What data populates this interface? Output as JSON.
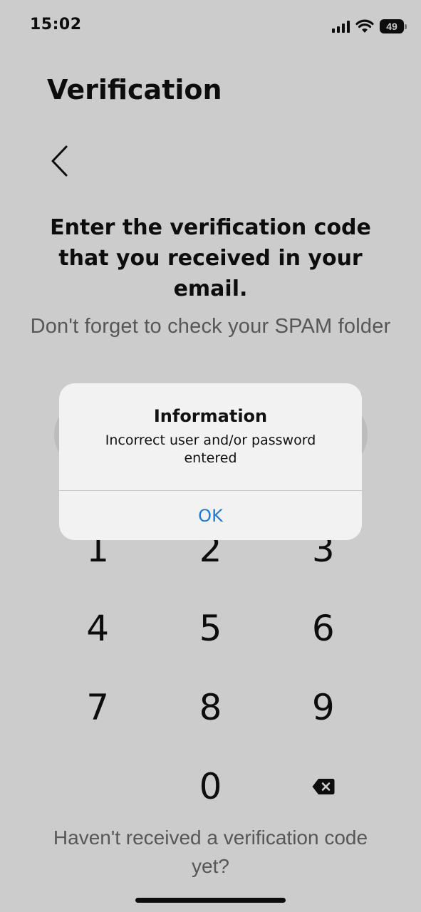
{
  "status_bar": {
    "time": "15:02",
    "battery": "49",
    "icons": [
      "signal-icon",
      "wifi-icon",
      "battery-icon"
    ]
  },
  "header": {
    "title": "Verification",
    "back_icon": "chevron-left-icon"
  },
  "main": {
    "instruction": "Enter the verification code that you received in your email.",
    "hint": "Don't forget to check your SPAM folder",
    "resend": "Haven't received a verification code yet?"
  },
  "keypad": {
    "keys": [
      "1",
      "2",
      "3",
      "4",
      "5",
      "6",
      "7",
      "8",
      "9",
      "0"
    ],
    "backspace_icon": "backspace-icon"
  },
  "dialog": {
    "title": "Information",
    "message": "Incorrect user and/or password entered",
    "ok_label": "OK"
  },
  "colors": {
    "accent": "#1a7bd9",
    "hint_text": "#6d6d6d",
    "text": "#111111"
  }
}
